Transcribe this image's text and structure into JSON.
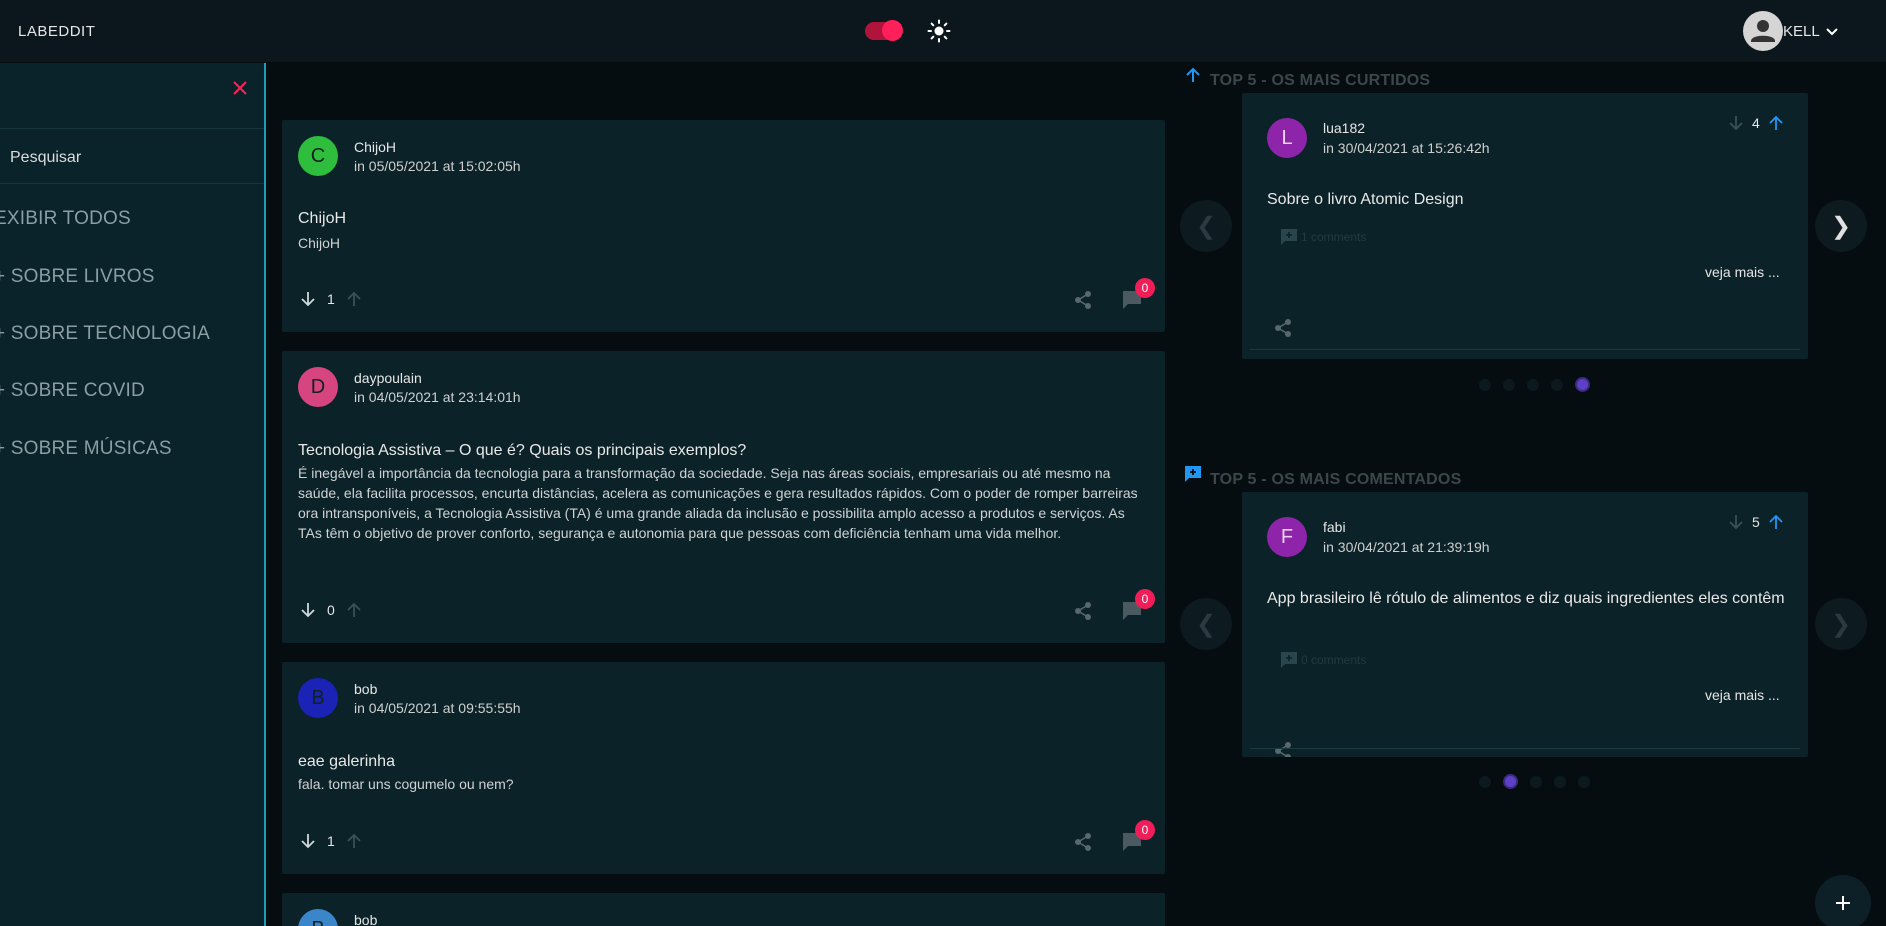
{
  "header": {
    "logo": "LABEDDIT",
    "user_name": "KELL"
  },
  "sidebar": {
    "search_label": "Pesquisar",
    "items": [
      {
        "label": "EXIBIR TODOS"
      },
      {
        "label": "+ SOBRE LIVROS"
      },
      {
        "label": "+ SOBRE TECNOLOGIA"
      },
      {
        "label": "+ SOBRE COVID"
      },
      {
        "label": "+ SOBRE MÚSICAS"
      }
    ]
  },
  "posts": [
    {
      "initial": "C",
      "avatar_color": "#2ebd3d",
      "author": "ChijoH",
      "date": "in 05/05/2021 at 15:02:05h",
      "title": "ChijoH",
      "body": "ChijoH",
      "votes": "1",
      "comments": "0"
    },
    {
      "initial": "D",
      "avatar_color": "#d6457f",
      "author": "daypoulain",
      "date": "in 04/05/2021 at 23:14:01h",
      "title": "Tecnologia Assistiva – O que é? Quais os principais exemplos?",
      "body": "É inegável a importância da tecnologia para a transformação da sociedade. Seja nas áreas sociais, empresariais ou até mesmo na saúde, ela facilita processos, encurta distâncias, acelera as comunicações e gera resultados rápidos. Com o poder de romper barreiras ora intransponíveis, a Tecnologia Assistiva (TA) é uma grande aliada da inclusão e possibilita amplo acesso a produtos e serviços. As TAs têm o objetivo de prover conforto, segurança e autonomia para que pessoas com deficiência tenham uma vida melhor.",
      "votes": "0",
      "comments": "0"
    },
    {
      "initial": "B",
      "avatar_color": "#1a23b5",
      "author": "bob",
      "date": "in 04/05/2021 at 09:55:55h",
      "title": "eae galerinha",
      "body": "fala. tomar uns cogumelo ou nem?",
      "votes": "1",
      "comments": "0"
    },
    {
      "initial": "B",
      "avatar_color": "#3a86c9",
      "author": "bob"
    }
  ],
  "top_liked": {
    "title": "TOP 5 - OS MAIS CURTIDOS",
    "card": {
      "initial": "L",
      "author": "lua182",
      "date": "in 30/04/2021 at 15:26:42h",
      "votes": "4",
      "title": "Sobre o livro Atomic Design",
      "comments": "1 comments",
      "more": "veja mais ..."
    },
    "prev": "❮",
    "next": "❯"
  },
  "top_commented": {
    "title": "TOP 5 - OS MAIS COMENTADOS",
    "card": {
      "initial": "F",
      "author": "fabi",
      "date": "in 30/04/2021 at 21:39:19h",
      "votes": "5",
      "title": "App brasileiro lê rótulo de alimentos e diz quais ingredientes eles contêm",
      "comments": "0 comments",
      "more": "veja mais ..."
    },
    "prev": "❮",
    "next": "❯"
  },
  "colors": {
    "accent": "#ff1f5a",
    "up_arrow": "#2196f3",
    "sidebar_border": "#1e9bb8"
  }
}
